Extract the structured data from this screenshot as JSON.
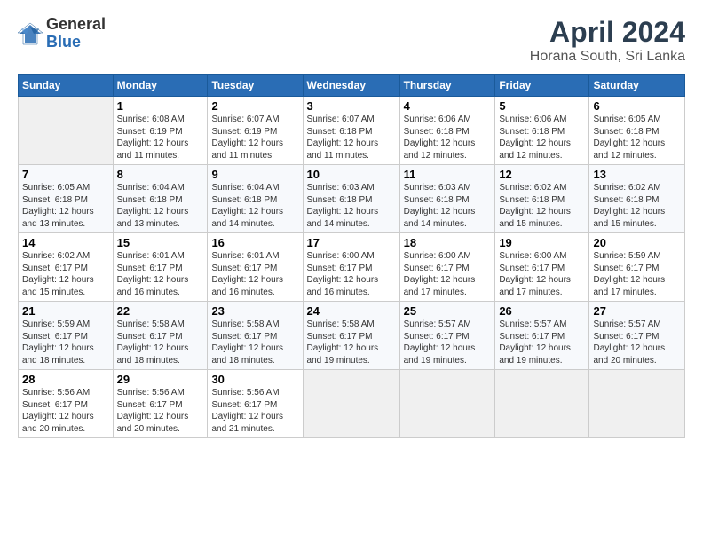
{
  "logo": {
    "general": "General",
    "blue": "Blue"
  },
  "title": "April 2024",
  "location": "Horana South, Sri Lanka",
  "days_of_week": [
    "Sunday",
    "Monday",
    "Tuesday",
    "Wednesday",
    "Thursday",
    "Friday",
    "Saturday"
  ],
  "weeks": [
    [
      {
        "day": "",
        "info": ""
      },
      {
        "day": "1",
        "info": "Sunrise: 6:08 AM\nSunset: 6:19 PM\nDaylight: 12 hours\nand 11 minutes."
      },
      {
        "day": "2",
        "info": "Sunrise: 6:07 AM\nSunset: 6:19 PM\nDaylight: 12 hours\nand 11 minutes."
      },
      {
        "day": "3",
        "info": "Sunrise: 6:07 AM\nSunset: 6:18 PM\nDaylight: 12 hours\nand 11 minutes."
      },
      {
        "day": "4",
        "info": "Sunrise: 6:06 AM\nSunset: 6:18 PM\nDaylight: 12 hours\nand 12 minutes."
      },
      {
        "day": "5",
        "info": "Sunrise: 6:06 AM\nSunset: 6:18 PM\nDaylight: 12 hours\nand 12 minutes."
      },
      {
        "day": "6",
        "info": "Sunrise: 6:05 AM\nSunset: 6:18 PM\nDaylight: 12 hours\nand 12 minutes."
      }
    ],
    [
      {
        "day": "7",
        "info": "Sunrise: 6:05 AM\nSunset: 6:18 PM\nDaylight: 12 hours\nand 13 minutes."
      },
      {
        "day": "8",
        "info": "Sunrise: 6:04 AM\nSunset: 6:18 PM\nDaylight: 12 hours\nand 13 minutes."
      },
      {
        "day": "9",
        "info": "Sunrise: 6:04 AM\nSunset: 6:18 PM\nDaylight: 12 hours\nand 14 minutes."
      },
      {
        "day": "10",
        "info": "Sunrise: 6:03 AM\nSunset: 6:18 PM\nDaylight: 12 hours\nand 14 minutes."
      },
      {
        "day": "11",
        "info": "Sunrise: 6:03 AM\nSunset: 6:18 PM\nDaylight: 12 hours\nand 14 minutes."
      },
      {
        "day": "12",
        "info": "Sunrise: 6:02 AM\nSunset: 6:18 PM\nDaylight: 12 hours\nand 15 minutes."
      },
      {
        "day": "13",
        "info": "Sunrise: 6:02 AM\nSunset: 6:18 PM\nDaylight: 12 hours\nand 15 minutes."
      }
    ],
    [
      {
        "day": "14",
        "info": "Sunrise: 6:02 AM\nSunset: 6:17 PM\nDaylight: 12 hours\nand 15 minutes."
      },
      {
        "day": "15",
        "info": "Sunrise: 6:01 AM\nSunset: 6:17 PM\nDaylight: 12 hours\nand 16 minutes."
      },
      {
        "day": "16",
        "info": "Sunrise: 6:01 AM\nSunset: 6:17 PM\nDaylight: 12 hours\nand 16 minutes."
      },
      {
        "day": "17",
        "info": "Sunrise: 6:00 AM\nSunset: 6:17 PM\nDaylight: 12 hours\nand 16 minutes."
      },
      {
        "day": "18",
        "info": "Sunrise: 6:00 AM\nSunset: 6:17 PM\nDaylight: 12 hours\nand 17 minutes."
      },
      {
        "day": "19",
        "info": "Sunrise: 6:00 AM\nSunset: 6:17 PM\nDaylight: 12 hours\nand 17 minutes."
      },
      {
        "day": "20",
        "info": "Sunrise: 5:59 AM\nSunset: 6:17 PM\nDaylight: 12 hours\nand 17 minutes."
      }
    ],
    [
      {
        "day": "21",
        "info": "Sunrise: 5:59 AM\nSunset: 6:17 PM\nDaylight: 12 hours\nand 18 minutes."
      },
      {
        "day": "22",
        "info": "Sunrise: 5:58 AM\nSunset: 6:17 PM\nDaylight: 12 hours\nand 18 minutes."
      },
      {
        "day": "23",
        "info": "Sunrise: 5:58 AM\nSunset: 6:17 PM\nDaylight: 12 hours\nand 18 minutes."
      },
      {
        "day": "24",
        "info": "Sunrise: 5:58 AM\nSunset: 6:17 PM\nDaylight: 12 hours\nand 19 minutes."
      },
      {
        "day": "25",
        "info": "Sunrise: 5:57 AM\nSunset: 6:17 PM\nDaylight: 12 hours\nand 19 minutes."
      },
      {
        "day": "26",
        "info": "Sunrise: 5:57 AM\nSunset: 6:17 PM\nDaylight: 12 hours\nand 19 minutes."
      },
      {
        "day": "27",
        "info": "Sunrise: 5:57 AM\nSunset: 6:17 PM\nDaylight: 12 hours\nand 20 minutes."
      }
    ],
    [
      {
        "day": "28",
        "info": "Sunrise: 5:56 AM\nSunset: 6:17 PM\nDaylight: 12 hours\nand 20 minutes."
      },
      {
        "day": "29",
        "info": "Sunrise: 5:56 AM\nSunset: 6:17 PM\nDaylight: 12 hours\nand 20 minutes."
      },
      {
        "day": "30",
        "info": "Sunrise: 5:56 AM\nSunset: 6:17 PM\nDaylight: 12 hours\nand 21 minutes."
      },
      {
        "day": "",
        "info": ""
      },
      {
        "day": "",
        "info": ""
      },
      {
        "day": "",
        "info": ""
      },
      {
        "day": "",
        "info": ""
      }
    ]
  ]
}
